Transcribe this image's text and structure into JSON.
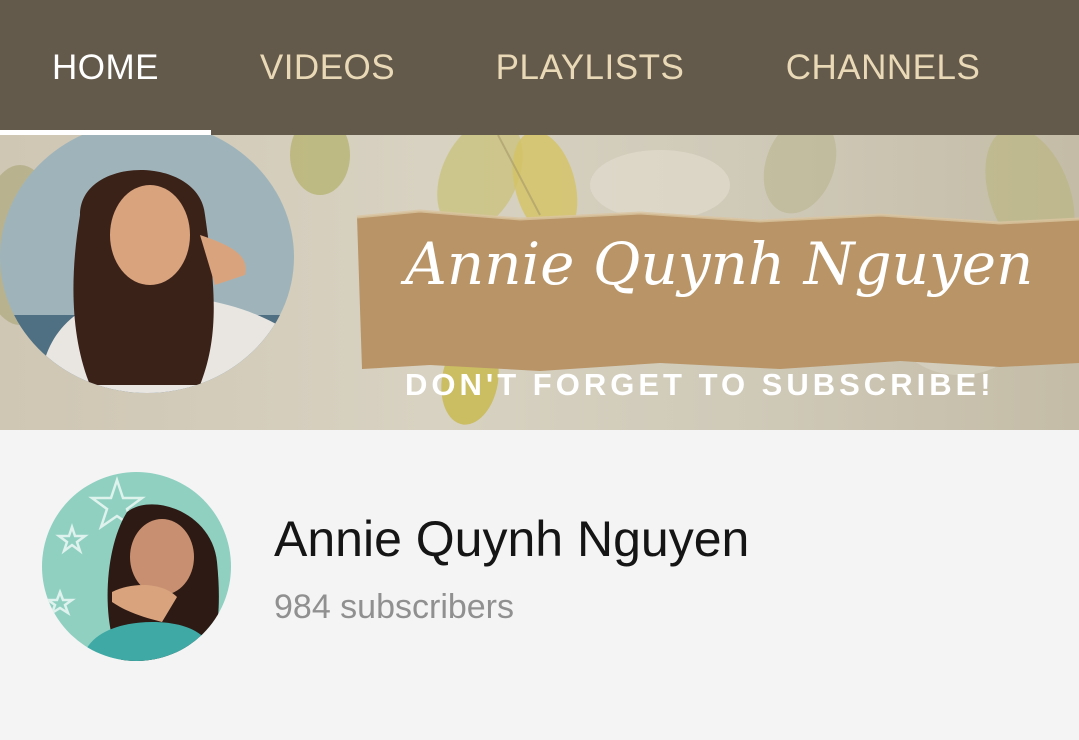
{
  "tabs": [
    {
      "label": "HOME",
      "active": true
    },
    {
      "label": "VIDEOS",
      "active": false
    },
    {
      "label": "PLAYLISTS",
      "active": false
    },
    {
      "label": "CHANNELS",
      "active": false
    }
  ],
  "banner": {
    "script_title": "Annie Quynh Nguyen",
    "subscribe_text": "DON'T FORGET TO SUBSCRIBE!"
  },
  "channel": {
    "name": "Annie Quynh Nguyen",
    "subscribers": "984 subscribers"
  },
  "colors": {
    "tabbar": "#645a4c",
    "tab_text": "#ead9b6",
    "tab_active": "#ffffff",
    "kraft_paper": "#b89466",
    "background": "#f4f4f4"
  }
}
